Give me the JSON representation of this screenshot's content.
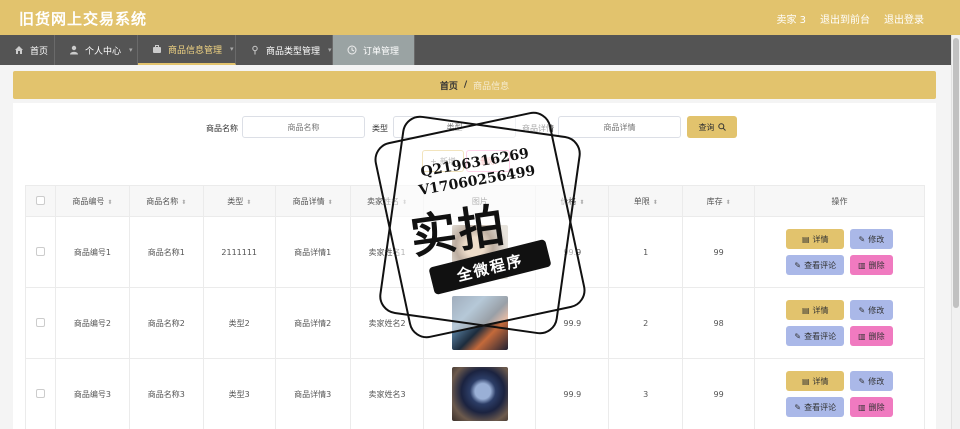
{
  "app": {
    "title": "旧货网上交易系统"
  },
  "header": {
    "user": "卖家 3",
    "to_front": "退出到前台",
    "logout": "退出登录"
  },
  "nav": [
    {
      "label": "首页",
      "icon": "home-icon"
    },
    {
      "label": "个人中心",
      "icon": "user-icon"
    },
    {
      "label": "商品信息管理",
      "icon": "briefcase-icon"
    },
    {
      "label": "商品类型管理",
      "icon": "pin-icon"
    },
    {
      "label": "订单管理",
      "icon": "clock-icon"
    }
  ],
  "breadcrumb": {
    "home": "首页",
    "separator": "/",
    "current": "商品信息"
  },
  "search": {
    "name_label": "商品名称",
    "name_placeholder": "商品名称",
    "type_label": "类型",
    "type_placeholder": "类型",
    "detail_label": "商品详情",
    "detail_placeholder": "商品详情",
    "button": "查询"
  },
  "toolbar": {
    "add": "新增",
    "delete": "删除"
  },
  "table": {
    "headers": [
      "商品编号",
      "商品名称",
      "类型",
      "商品详情",
      "卖家姓名",
      "图片",
      "价格",
      "单限",
      "库存",
      "操作"
    ],
    "rows": [
      {
        "code": "商品编号1",
        "name": "商品名称1",
        "type": "2111111",
        "detail": "商品详情1",
        "seller": "卖家姓名1",
        "price": "99.9",
        "limit": "1",
        "stock": "99"
      },
      {
        "code": "商品编号2",
        "name": "商品名称2",
        "type": "类型2",
        "detail": "商品详情2",
        "seller": "卖家姓名2",
        "price": "99.9",
        "limit": "2",
        "stock": "98"
      },
      {
        "code": "商品编号3",
        "name": "商品名称3",
        "type": "类型3",
        "detail": "商品详情3",
        "seller": "卖家姓名3",
        "price": "99.9",
        "limit": "3",
        "stock": "99"
      }
    ],
    "ops": {
      "detail": "详情",
      "edit": "修改",
      "comment": "查看评论",
      "delete": "删除"
    }
  },
  "watermark": {
    "line1": "Q2196316269",
    "line2": "V17060256499",
    "big": "实拍",
    "band": "全微程序"
  }
}
